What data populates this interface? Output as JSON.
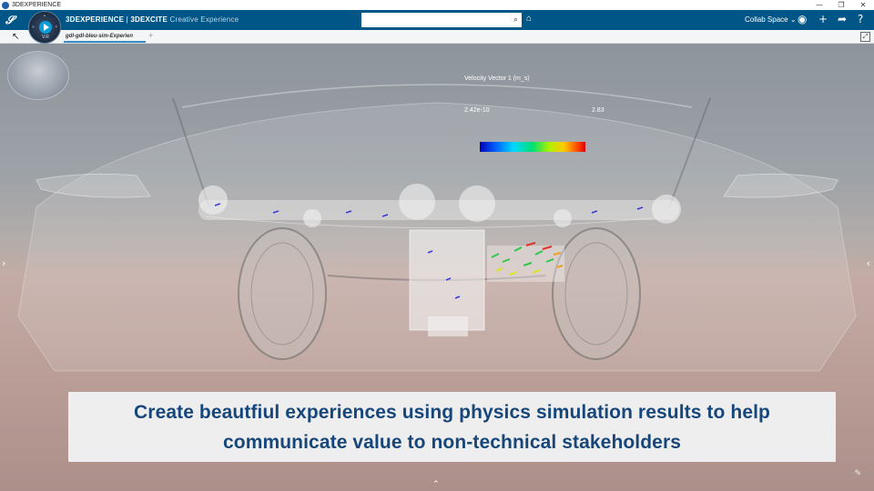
{
  "os": {
    "title": "3DEXPERIENCE",
    "controls": [
      "—",
      "❐",
      "✕"
    ]
  },
  "top_bar": {
    "brand_main": "3DEXPERIENCE",
    "brand_separator": " | ",
    "brand_app": "3DEXCITE",
    "brand_sub": " Creative Experience",
    "compass_version": "V.R",
    "search_placeholder": "",
    "collab_space": "Collab Space",
    "icons": [
      "user-icon",
      "add-icon",
      "share-icon",
      "help-icon"
    ]
  },
  "tab_bar": {
    "tab_label": "gdl-gdl-bleu-sim-Experien",
    "add_label": "+"
  },
  "viewport": {
    "legend": {
      "title": "Velocity Vector 1 (m_s)",
      "min": "2.42e-10",
      "max": "2.83"
    },
    "caption": {
      "line1": "Create beautfiul experiences using physics simulation results to help",
      "line2": "communicate value to non-technical stakeholders"
    }
  },
  "colors": {
    "top_bar": "#005686",
    "caption_text": "#17477a",
    "tab_accent": "#368ec4"
  }
}
